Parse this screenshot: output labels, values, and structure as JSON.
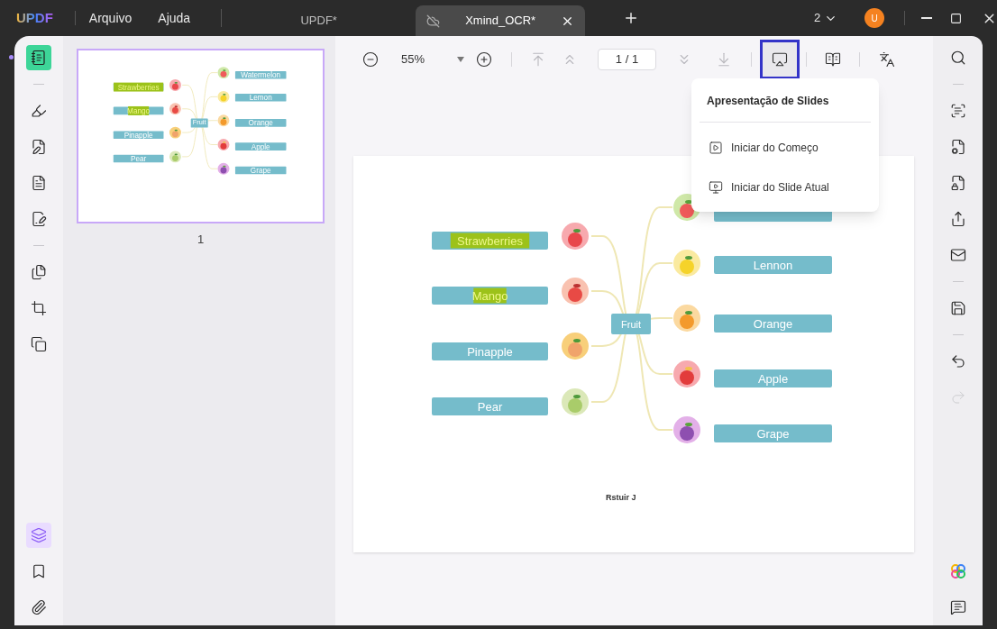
{
  "title_bar": {
    "logo": "UPDF",
    "menus": [
      "Arquivo",
      "Ajuda"
    ],
    "tabs": [
      {
        "label": "UPDF*",
        "selected": false
      },
      {
        "label": "Xmind_OCR*",
        "selected": true
      }
    ],
    "window_count": "2",
    "avatar": "U"
  },
  "left_tools": {
    "top": [
      {
        "selected": true
      },
      {
        "selected": false
      },
      {
        "selected": false
      },
      {
        "selected": false
      },
      {
        "selected": false
      },
      {
        "selected": false
      },
      {
        "selected": false
      },
      {
        "selected": false
      }
    ],
    "bottom": [
      {
        "selected": true
      },
      {
        "selected": false
      },
      {
        "selected": false
      }
    ]
  },
  "thumbnails": [
    {
      "page_number": "1",
      "selected": true,
      "preview": {
        "center": "Fruit",
        "left": [
          {
            "label": "Strawberries",
            "highlighted": true
          },
          {
            "label": "Mango",
            "highlighted": true
          },
          {
            "label": "Pinapple",
            "highlighted": false
          },
          {
            "label": "Pear",
            "highlighted": false
          }
        ],
        "right": [
          {
            "label": "Watermelon",
            "highlighted": false
          },
          {
            "label": "Lemon",
            "highlighted": false
          },
          {
            "label": "Orange",
            "highlighted": false
          },
          {
            "label": "Apple",
            "highlighted": false
          },
          {
            "label": "Grape",
            "highlighted": false
          }
        ]
      }
    }
  ],
  "toolbar": {
    "zoom": "55%",
    "page": "1 / 1",
    "nav": [
      {
        "disabled": true
      },
      {
        "disabled": true
      },
      {
        "disabled": true
      },
      {
        "disabled": true
      }
    ],
    "slideshow_selected": true
  },
  "slideshow_menu": {
    "title": "Apresentação de Slides",
    "items": [
      "Iniciar do Começo",
      "Iniciar do Slide Atual"
    ]
  },
  "page": {
    "center": "Fruit",
    "left": [
      {
        "label": "Strawberries",
        "highlighted": true
      },
      {
        "label": "Mango",
        "highlighted": true
      },
      {
        "label": "Pinapple",
        "highlighted": false
      },
      {
        "label": "Pear",
        "highlighted": false
      }
    ],
    "right": [
      {
        "highlighted": false
      },
      {
        "label": "Lennon",
        "highlighted": false
      },
      {
        "label": "Orange",
        "highlighted": false
      },
      {
        "label": "Apple",
        "highlighted": false
      },
      {
        "label": "Grape",
        "highlighted": false
      }
    ],
    "caption": "Rstuir J"
  },
  "right_tools": [
    {
      "disabled": false
    },
    {
      "disabled": false
    },
    {
      "disabled": false
    },
    {
      "disabled": false
    },
    {
      "disabled": false
    },
    {
      "disabled": false
    },
    {
      "disabled": false
    },
    {
      "disabled": false
    },
    {
      "disabled": true
    }
  ]
}
